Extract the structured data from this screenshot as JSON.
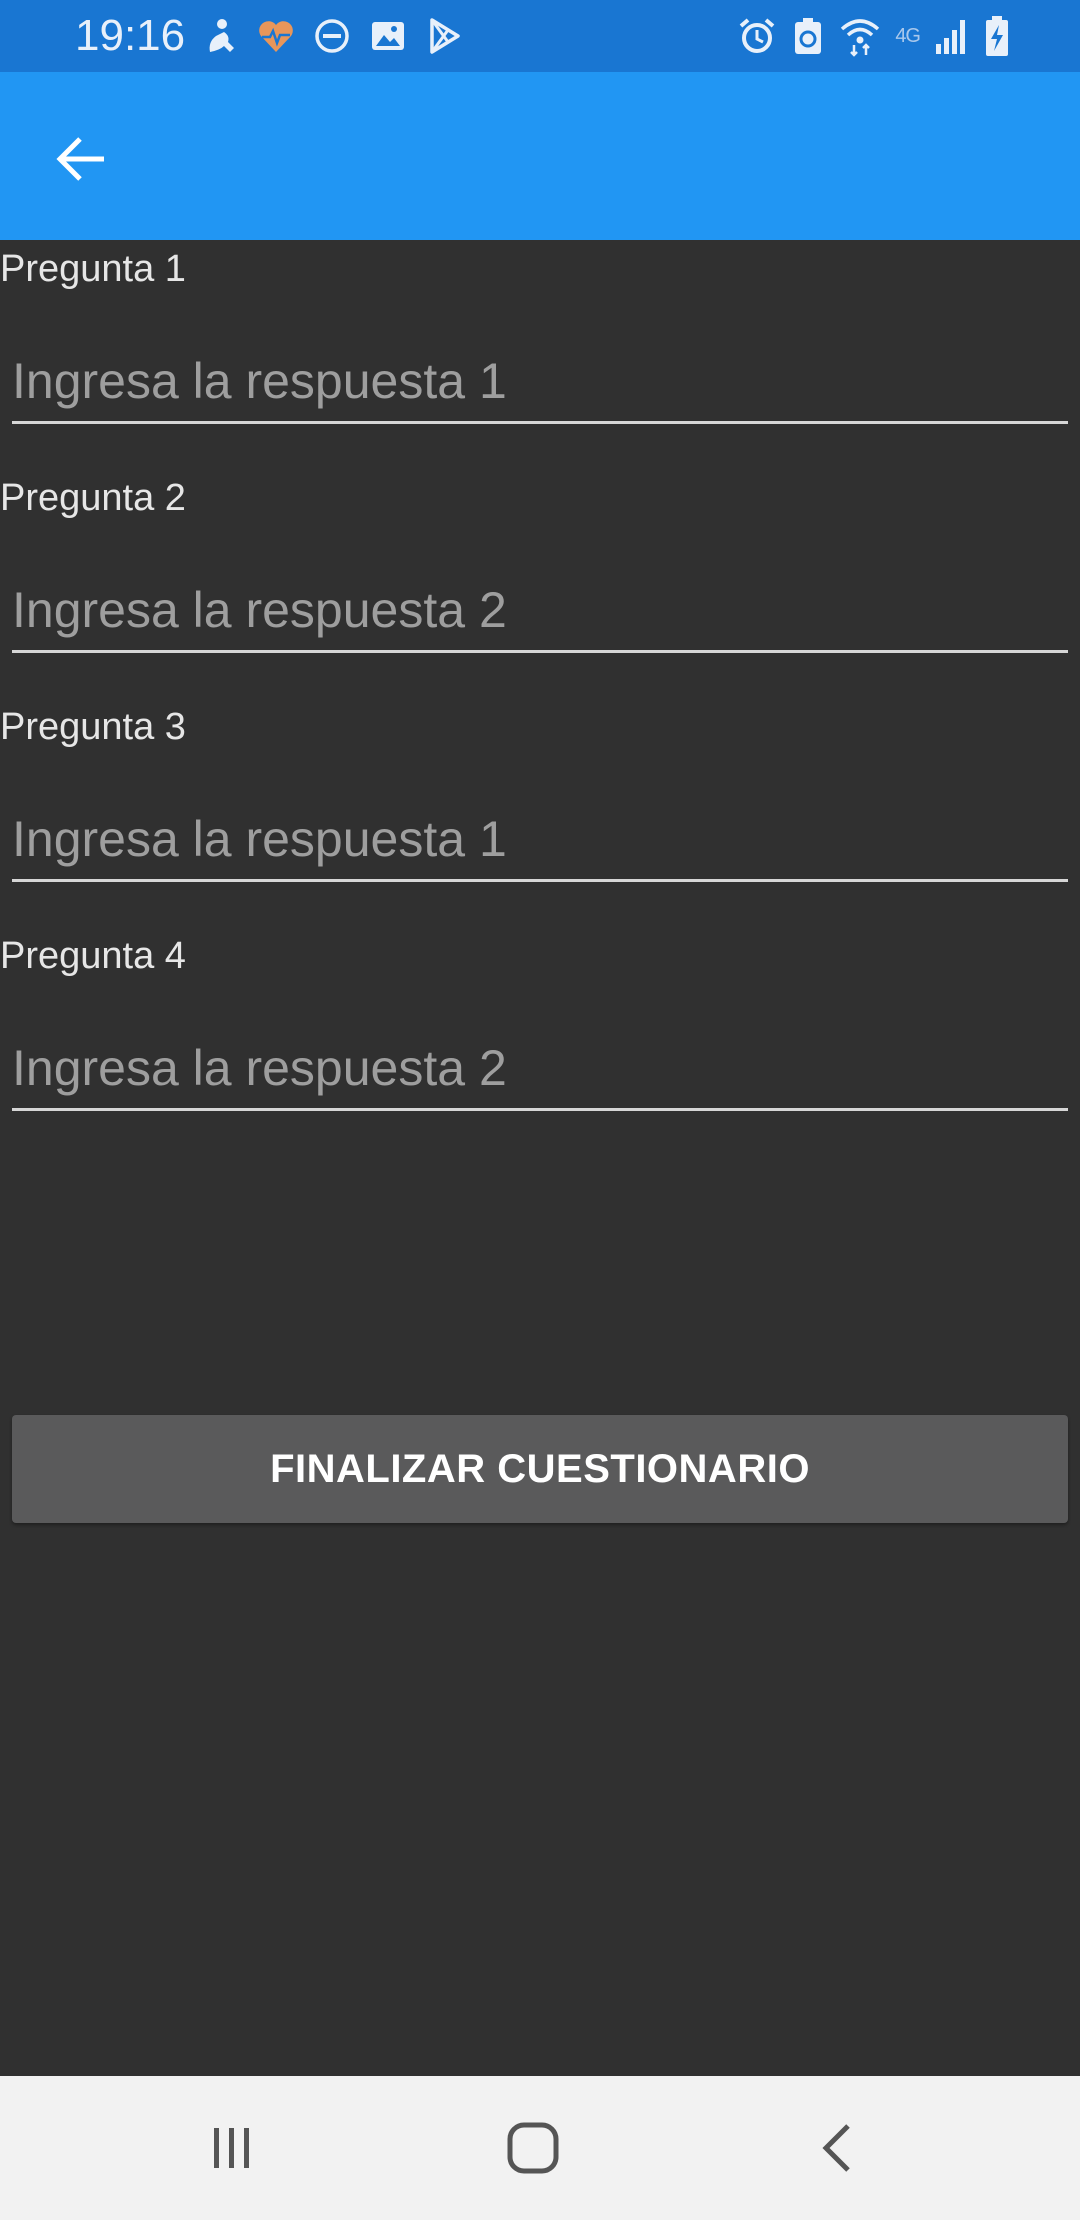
{
  "status_bar": {
    "time": "19:16",
    "left_icons": [
      "accessibility-icon",
      "health-heart-icon",
      "do-not-disturb-icon",
      "gallery-icon",
      "play-store-icon"
    ],
    "right_icons": [
      "alarm-icon",
      "battery-saver-icon",
      "wifi-icon",
      "network-4g-icon",
      "signal-icon",
      "battery-charging-icon"
    ],
    "network_label": "4G",
    "colors": {
      "background": "#1976D2",
      "heart": "#e8965a"
    }
  },
  "app_bar": {
    "back_icon": "arrow-back-icon",
    "color": "#2196F3"
  },
  "questions": [
    {
      "label": "Pregunta 1",
      "placeholder": "Ingresa la respuesta 1",
      "value": ""
    },
    {
      "label": "Pregunta 2",
      "placeholder": "Ingresa la respuesta 2",
      "value": ""
    },
    {
      "label": "Pregunta 3",
      "placeholder": "Ingresa la respuesta 1",
      "value": ""
    },
    {
      "label": "Pregunta 4",
      "placeholder": "Ingresa la respuesta 2",
      "value": ""
    }
  ],
  "finish_button": {
    "label": "FINALIZAR CUESTIONARIO"
  },
  "nav_bar": {
    "items": [
      "recent-apps-icon",
      "home-icon",
      "back-icon"
    ]
  }
}
